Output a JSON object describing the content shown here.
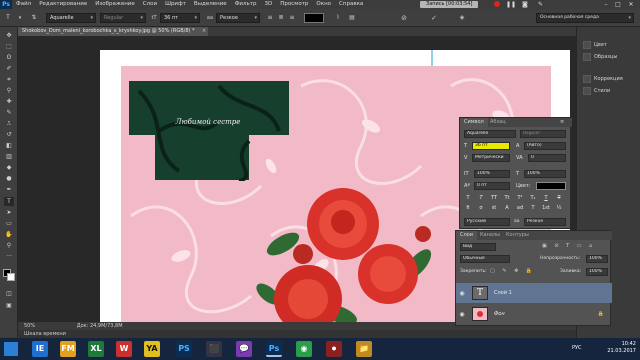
{
  "app": {
    "logo": "Ps",
    "menu": [
      "Файл",
      "Редактирование",
      "Изображение",
      "Слои",
      "Шрифт",
      "Выделение",
      "Фильтр",
      "3D",
      "Просмотр",
      "Окно",
      "Справка"
    ],
    "recording": "Запись [00:03:54]",
    "window_controls": [
      "–",
      "□",
      "✕"
    ]
  },
  "options": {
    "font_family": "Aquarelle",
    "font_style": "Regular",
    "font_size": "36 пт",
    "antialias": "Резкое",
    "workspace": "Основная рабочая среда"
  },
  "document": {
    "tab_title": "Shokobov_Dom_maleni_korobochka_s_kryshkoy.jpg @ 50% (RGB/8) *",
    "label_text": "Любимой сестре",
    "zoom": "50%",
    "doc_size": "Док: 24,9M/73,8M",
    "timeline": "Шкала времени",
    "colors": {
      "pink": "#f2b9c6",
      "dark_green": "#173f2e",
      "rose": "#d9322a",
      "leaf": "#2f6a33"
    }
  },
  "dock": {
    "items": [
      {
        "label": "Цвет",
        "icon": "color-icon"
      },
      {
        "label": "Образцы",
        "icon": "swatches-icon"
      },
      {
        "label": "Коррекция",
        "icon": "adjustments-icon"
      },
      {
        "label": "Стили",
        "icon": "styles-icon"
      }
    ]
  },
  "character": {
    "tabs": [
      "Символ",
      "Абзац"
    ],
    "font_family": "Aquarelle",
    "font_style": "Regular",
    "font_size": "36 пт",
    "leading": "(Авто)",
    "kerning": "Метрически",
    "tracking": "0",
    "vscale": "100%",
    "hscale": "100%",
    "baseline": "0 пт",
    "color_label": "Цвет:",
    "language": "Русский",
    "antialias": "Резкое",
    "style_buttons": [
      "T",
      "T",
      "TT",
      "Tt",
      "T¹",
      "T₁",
      "T",
      "T"
    ],
    "ot_buttons": [
      "fi",
      "σ",
      "st",
      "A",
      "ad",
      "T",
      "1st",
      "½"
    ]
  },
  "layers": {
    "tabs": [
      "Слои",
      "Каналы",
      "Контуры"
    ],
    "filter_label": "Вид",
    "blend_mode": "Обычные",
    "opacity_label": "Непрозрачность:",
    "opacity": "100%",
    "lock_label": "Закрепить:",
    "fill_label": "Заливка:",
    "fill": "100%",
    "items": [
      {
        "name": "Слой 1",
        "type": "text",
        "thumb": "T"
      },
      {
        "name": "Фон",
        "type": "image",
        "thumb": ""
      }
    ]
  },
  "taskbar": {
    "apps": [
      "IE",
      "FM",
      "XL",
      "W",
      "YA",
      "PS",
      "⬛",
      "💬",
      "Ps",
      "◉",
      "⏺",
      "📁"
    ],
    "lang": "РУС",
    "time": "10:42",
    "date": "21.03.2017"
  }
}
